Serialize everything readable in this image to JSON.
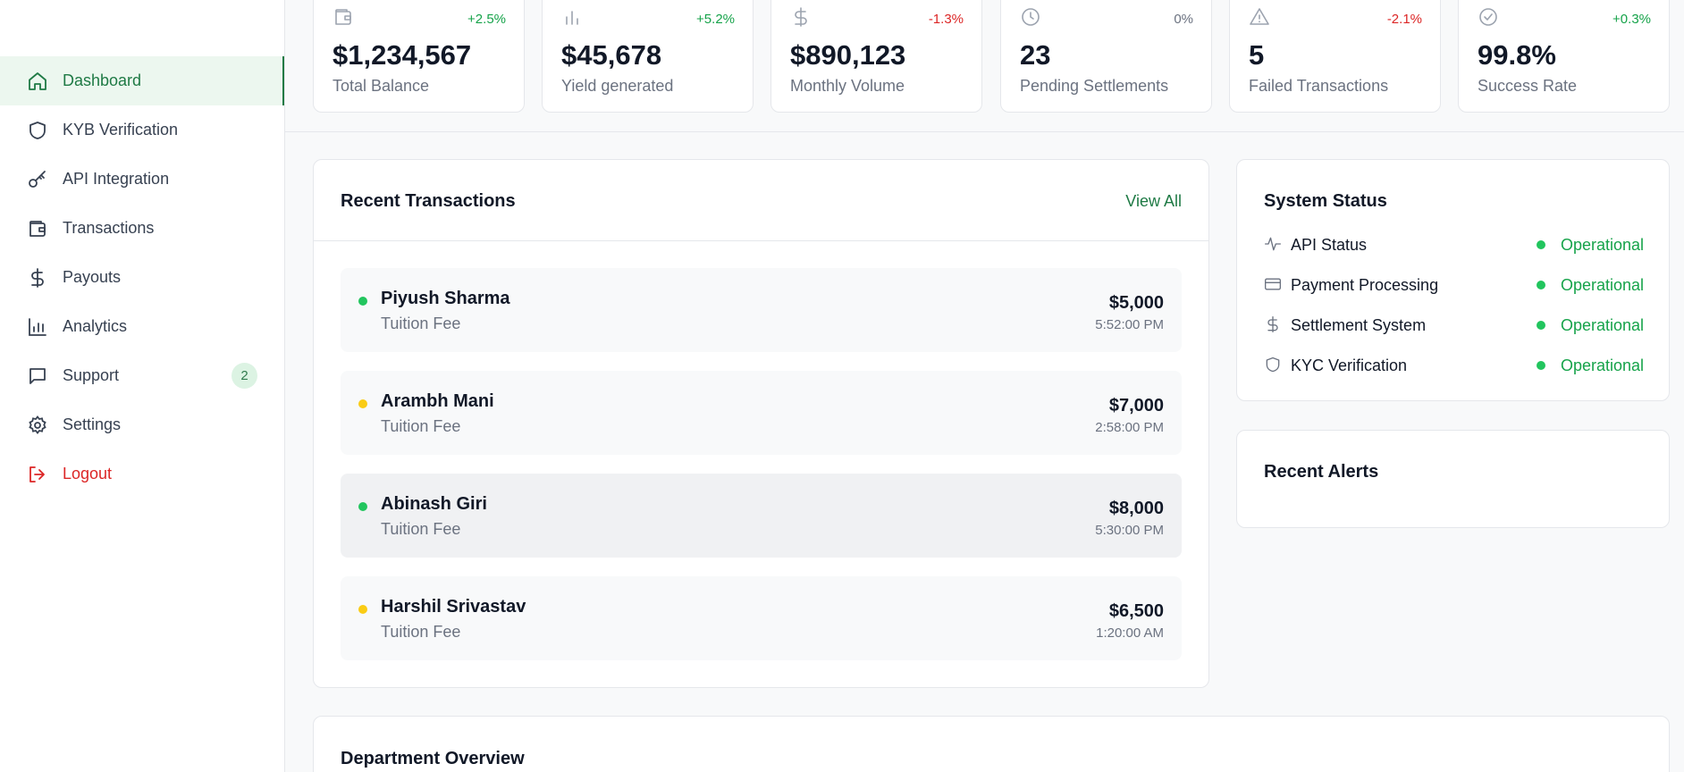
{
  "sidebar": {
    "items": [
      {
        "label": "Dashboard",
        "icon": "home-icon"
      },
      {
        "label": "KYB Verification",
        "icon": "shield-icon"
      },
      {
        "label": "API Integration",
        "icon": "key-icon"
      },
      {
        "label": "Transactions",
        "icon": "wallet-icon"
      },
      {
        "label": "Payouts",
        "icon": "dollar-icon"
      },
      {
        "label": "Analytics",
        "icon": "bar-chart-icon"
      },
      {
        "label": "Support",
        "icon": "message-icon",
        "badge": "2"
      },
      {
        "label": "Settings",
        "icon": "gear-icon"
      },
      {
        "label": "Logout",
        "icon": "logout-icon"
      }
    ]
  },
  "stats": [
    {
      "value": "$1,234,567",
      "label": "Total Balance",
      "change": "+2.5%",
      "icon": "wallet-icon"
    },
    {
      "value": "$45,678",
      "label": "Yield generated",
      "change": "+5.2%",
      "icon": "bar-chart-icon"
    },
    {
      "value": "$890,123",
      "label": "Monthly Volume",
      "change": "-1.3%",
      "icon": "dollar-icon"
    },
    {
      "value": "23",
      "label": "Pending Settlements",
      "change": "0%",
      "icon": "clock-icon"
    },
    {
      "value": "5",
      "label": "Failed Transactions",
      "change": "-2.1%",
      "icon": "warning-icon"
    },
    {
      "value": "99.8%",
      "label": "Success Rate",
      "change": "+0.3%",
      "icon": "check-circle-icon"
    }
  ],
  "transactions": {
    "title": "Recent Transactions",
    "view_all": "View All",
    "rows": [
      {
        "name": "Piyush Sharma",
        "desc": "Tuition Fee",
        "amount": "$5,000",
        "time": "5:52:00 PM",
        "status_color": "#22c55e"
      },
      {
        "name": "Arambh Mani",
        "desc": "Tuition Fee",
        "amount": "$7,000",
        "time": "2:58:00 PM",
        "status_color": "#facc15"
      },
      {
        "name": "Abinash Giri",
        "desc": "Tuition Fee",
        "amount": "$8,000",
        "time": "5:30:00 PM",
        "status_color": "#22c55e"
      },
      {
        "name": "Harshil Srivastav",
        "desc": "Tuition Fee",
        "amount": "$6,500",
        "time": "1:20:00 AM",
        "status_color": "#facc15"
      }
    ]
  },
  "system_status": {
    "title": "System Status",
    "items": [
      {
        "name": "API Status",
        "value": "Operational",
        "icon": "activity-icon"
      },
      {
        "name": "Payment Processing",
        "value": "Operational",
        "icon": "credit-card-icon"
      },
      {
        "name": "Settlement System",
        "value": "Operational",
        "icon": "dollar-icon"
      },
      {
        "name": "KYC Verification",
        "value": "Operational",
        "icon": "shield-icon"
      }
    ]
  },
  "alerts": {
    "title": "Recent Alerts"
  },
  "department": {
    "title": "Department Overview"
  },
  "colors": {
    "accent": "#1f7a45",
    "positive": "#16a34a",
    "negative": "#dc2626",
    "active_bg": "#ecf7ef"
  }
}
